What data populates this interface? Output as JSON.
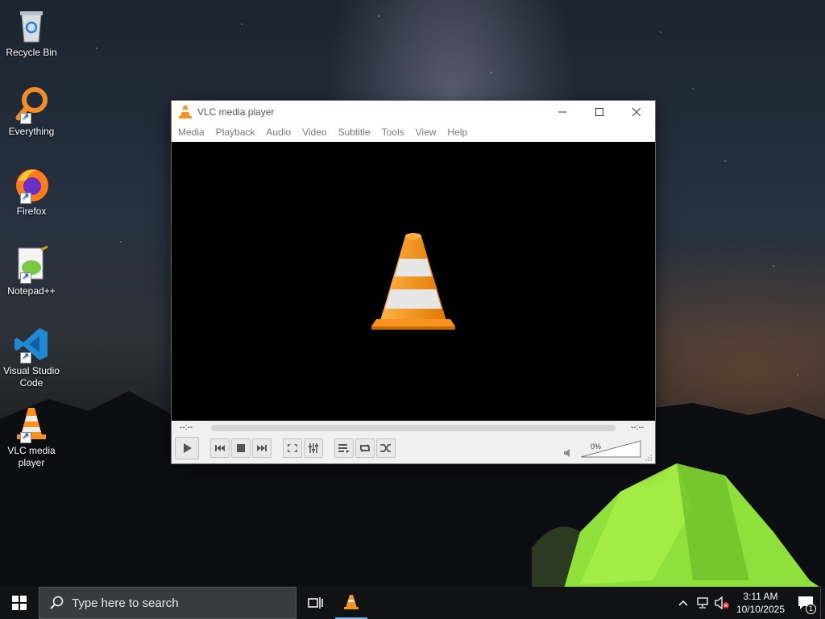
{
  "desktop": {
    "icons": [
      {
        "label": "Recycle Bin",
        "icon": "recycle-bin-icon"
      },
      {
        "label": "Everything",
        "icon": "everything-search-icon"
      },
      {
        "label": "Firefox",
        "icon": "firefox-icon"
      },
      {
        "label": "Notepad++",
        "icon": "notepad-plus-plus-icon"
      },
      {
        "label": "Visual Studio Code",
        "icon": "vscode-icon"
      },
      {
        "label": "VLC media player",
        "icon": "vlc-icon"
      }
    ]
  },
  "vlc": {
    "title": "VLC media player",
    "menu": [
      "Media",
      "Playback",
      "Audio",
      "Video",
      "Subtitle",
      "Tools",
      "View",
      "Help"
    ],
    "elapsed": "--:--",
    "remaining": "--:--",
    "volume_label": "0%",
    "volume_level": 0,
    "colors": {
      "cone_orange": "#f7931e",
      "video_bg": "#000000"
    }
  },
  "taskbar": {
    "search_placeholder": "Type here to search",
    "time": "3:11 AM",
    "date": "10/10/2025",
    "notification_count": "1"
  }
}
